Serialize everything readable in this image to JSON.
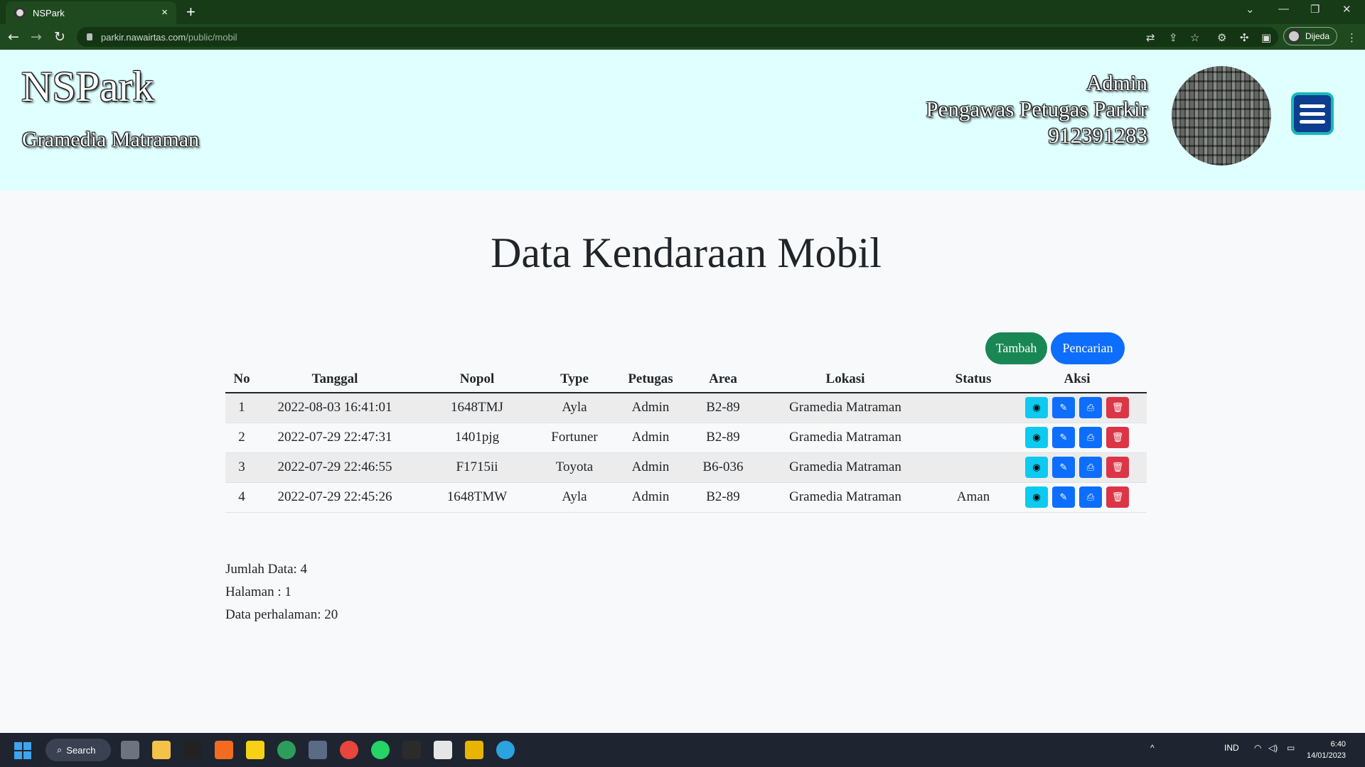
{
  "browser": {
    "tab_title": "NSPark",
    "tab_close": "×",
    "new_tab": "+",
    "url_host": "parkir.nawairtas.com",
    "url_path": "/public/mobil",
    "profile_name": "Dijeda"
  },
  "header": {
    "brand": "NSPark",
    "branch": "Gramedia Matraman",
    "user_role": "Admin",
    "user_title": "Pengawas Petugas Parkir",
    "user_phone": "912391283"
  },
  "main": {
    "title": "Data Kendaraan Mobil",
    "add_button": "Tambah",
    "search_button": "Pencarian",
    "columns": [
      "No",
      "Tanggal",
      "Nopol",
      "Type",
      "Petugas",
      "Area",
      "Lokasi",
      "Status",
      "Aksi"
    ],
    "rows": [
      {
        "no": "1",
        "tanggal": "2022-08-03 16:41:01",
        "nopol": "1648TMJ",
        "type": "Ayla",
        "petugas": "Admin",
        "area": "B2-89",
        "lokasi": "Gramedia Matraman",
        "status": ""
      },
      {
        "no": "2",
        "tanggal": "2022-07-29 22:47:31",
        "nopol": "1401pjg",
        "type": "Fortuner",
        "petugas": "Admin",
        "area": "B2-89",
        "lokasi": "Gramedia Matraman",
        "status": ""
      },
      {
        "no": "3",
        "tanggal": "2022-07-29 22:46:55",
        "nopol": "F1715ii",
        "type": "Toyota",
        "petugas": "Admin",
        "area": "B6-036",
        "lokasi": "Gramedia Matraman",
        "status": ""
      },
      {
        "no": "4",
        "tanggal": "2022-07-29 22:45:26",
        "nopol": "1648TMW",
        "type": "Ayla",
        "petugas": "Admin",
        "area": "B2-89",
        "lokasi": "Gramedia Matraman",
        "status": "Aman"
      }
    ],
    "action_icons": [
      "eye-icon",
      "user-edit-icon",
      "print-icon",
      "trash-icon"
    ],
    "summary": {
      "total": "Jumlah Data: 4",
      "page": "Halaman : 1",
      "per_page": "Data perhalaman: 20"
    }
  },
  "taskbar": {
    "search_label": "Search",
    "lang": "IND",
    "time": "6:40",
    "date": "14/01/2023"
  },
  "colors": {
    "header_bg": "#e0ffff",
    "btn_green": "#198754",
    "btn_blue": "#0d6efd",
    "btn_info": "#0dcaf0",
    "btn_danger": "#dc3545"
  }
}
